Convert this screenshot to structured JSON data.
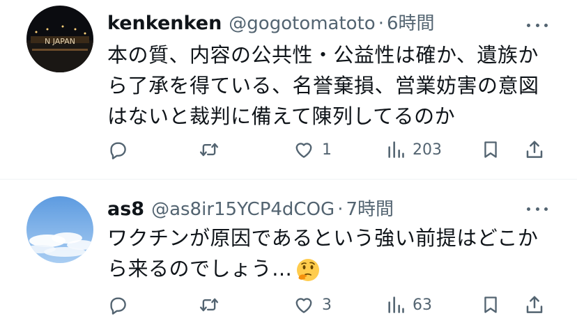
{
  "replies": [
    {
      "display_name": "kenkenken",
      "handle": "@gogotomatoto",
      "separator": "·",
      "time": "6時間",
      "text": "本の質、内容の公共性・公益性は確か、遺族から了承を得ている、名誉棄損、営業妨害の意図はないと裁判に備えて陳列してるのか",
      "avatar_text": "N JAPAN",
      "stats": {
        "replies": "",
        "retweets": "",
        "likes": "1",
        "views": "203"
      }
    },
    {
      "display_name": "as8",
      "handle": "@as8ir15YCP4dCOG",
      "separator": "·",
      "time": "7時間",
      "text": "ワクチンが原因であるという強い前提はどこから来るのでしょう…",
      "emoji": "thinking-face",
      "stats": {
        "replies": "",
        "retweets": "",
        "likes": "3",
        "views": "63"
      }
    }
  ],
  "icons": {
    "reply": "reply-icon",
    "retweet": "retweet-icon",
    "like": "heart-icon",
    "views": "views-icon",
    "bookmark": "bookmark-icon",
    "share": "share-icon",
    "more": "more-icon"
  },
  "colors": {
    "text": "#0f1419",
    "secondary": "#536471",
    "divider": "#eff3f4"
  }
}
